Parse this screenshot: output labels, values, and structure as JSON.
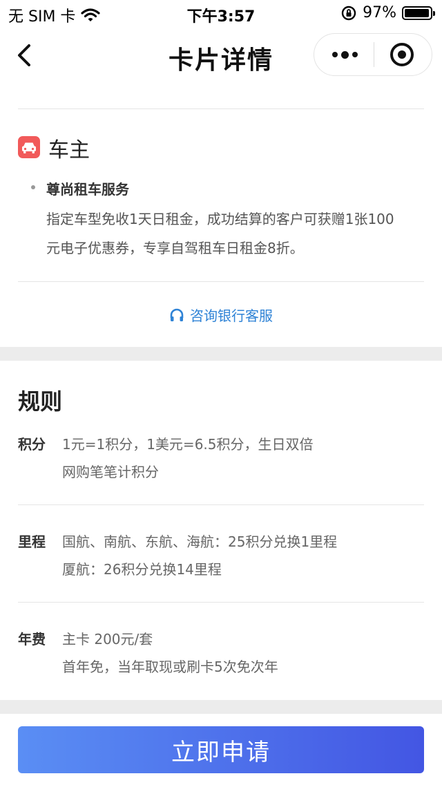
{
  "status_bar": {
    "carrier": "无 SIM 卡",
    "time": "下午3:57",
    "battery": "97%",
    "battery_level": 0.97
  },
  "nav": {
    "title": "卡片详情",
    "back_icon": "chevron-left-icon",
    "more_icon": "more-dots-icon",
    "close_icon": "target-close-icon"
  },
  "benefit_section": {
    "heading": "车主",
    "icon": "car-icon",
    "icon_color": "#f15a5a",
    "items": [
      {
        "title": "尊尚租车服务",
        "description_lines": [
          "指定车型免收1天日租金，成功结算的客户可获赠1张100",
          "元电子优惠券，专享自驾租车日租金8折。"
        ]
      }
    ],
    "consult_label": "咨询银行客服",
    "consult_color": "#2f83d6"
  },
  "rules": {
    "title": "规则",
    "items": [
      {
        "label": "积分",
        "lines": [
          "1元=1积分，1美元=6.5积分，生日双倍",
          "网购笔笔计积分"
        ]
      },
      {
        "label": "里程",
        "lines": [
          "国航、南航、东航、海航：25积分兑换1里程",
          "厦航：26积分兑换14里程"
        ]
      },
      {
        "label": "年费",
        "lines": [
          "主卡 200元/套",
          "首年免，当年取现或刷卡5次免次年"
        ]
      }
    ]
  },
  "apply_button": {
    "label": "立即申请",
    "gradient": [
      "#5a8ef4",
      "#4356e3"
    ]
  }
}
